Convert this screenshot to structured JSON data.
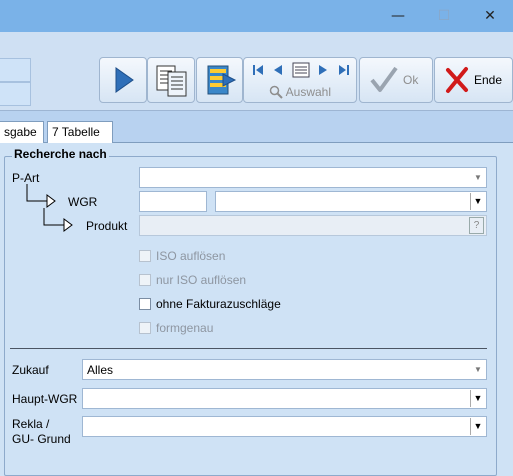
{
  "window": {
    "controls": {
      "minimize": "—",
      "maximize": "☐",
      "close": "✕"
    }
  },
  "toolbar": {
    "auswahl_label": "Auswahl",
    "ok_label": "Ok",
    "ende_label": "Ende"
  },
  "tabs": [
    {
      "label": "sgabe"
    },
    {
      "label": "7 Tabelle"
    }
  ],
  "section": {
    "title": "Recherche nach",
    "fields": {
      "part_label": "P-Art",
      "part_value": "",
      "wgr_label": "WGR",
      "wgr_code": "",
      "wgr_value": "",
      "produkt_label": "Produkt",
      "produkt_value": "",
      "produkt_help": "?"
    },
    "checkboxes": [
      {
        "label": "ISO auflösen",
        "enabled": false
      },
      {
        "label": "nur ISO auflösen",
        "enabled": false
      },
      {
        "label": "ohne Fakturazuschläge",
        "enabled": true
      },
      {
        "label": "formgenau",
        "enabled": false
      }
    ]
  },
  "lower": {
    "zukauf_label": "Zukauf",
    "zukauf_value": "Alles",
    "haupt_wgr_label": "Haupt-WGR",
    "haupt_wgr_value": "",
    "rekla_label_line1": "Rekla /",
    "rekla_label_line2": "GU- Grund",
    "rekla_value": ""
  },
  "colors": {
    "titlebar": "#7ab2e8",
    "background": "#cfe2f5",
    "close_x": "#d11a1a",
    "play": "#2f6fb8"
  }
}
